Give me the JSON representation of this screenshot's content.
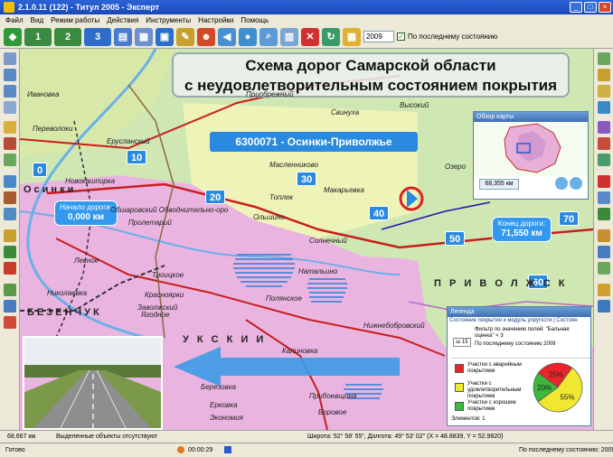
{
  "window": {
    "title": "2.1.0.11 (122) - Титул 2005 - Эксперт"
  },
  "menu": [
    "Файл",
    "Вид",
    "Режим работы",
    "Действия",
    "Инструменты",
    "Настройки",
    "Помощь"
  ],
  "toolbar": {
    "year": "2009",
    "last_state_label": "По последнему состоянию",
    "last_state_checked": "✓"
  },
  "map": {
    "title_line1": "Схема дорог Самарской области",
    "title_line2": "с неудовлетворительным состоянием покрытия",
    "route_label": "6300071 - Осинки-Приволжье",
    "km_markers": [
      "0",
      "10",
      "20",
      "30",
      "40",
      "50",
      "60",
      "70"
    ],
    "start": {
      "label": "Начало дороги:",
      "value": "0,000 км"
    },
    "end": {
      "label": "Конец дороги:",
      "value": "71,550 км"
    },
    "places": [
      "Ивановка",
      "Переволоки",
      "Ерусланский",
      "Приобрежный",
      "Свинуха",
      "Высокий",
      "Масленниково",
      "Осинки",
      "Новокашпирка",
      "Топлек",
      "Макарьевка",
      "Озеро",
      "Обшаровский Обводнительно-оро",
      "Ольшино",
      "Пролетарий",
      "Лесное",
      "Троицкое",
      "Полянское",
      "Солнечный",
      "Николаевка",
      "Ягодное",
      "Красноярки",
      "Заволжский",
      "Натальино",
      "Калиновка",
      "Нижнебобровский",
      "Прибоевщина",
      "Боровое",
      "Березовка",
      "Экономия",
      "Ерковка"
    ],
    "regions": {
      "west": "ОСИНКИ",
      "south": "БЕЗЕНЧУК",
      "south_east": "У К С К И И",
      "east": "П Р И В О Л Ж С К"
    }
  },
  "overview": {
    "title": "Обзор карты",
    "scale": "68,355 км"
  },
  "legend": {
    "title": "Легенда",
    "subtitle": "Состояние покрытия и модуль упругости | Состоян",
    "filter": "Фильтр по значению полей: \"Бальная оценка\" < 3",
    "ident": "ш 15",
    "last_state": "По последнему состоянию 2009",
    "items": [
      {
        "label": "Участки с аварийным покрытием",
        "color": "#e8262a"
      },
      {
        "label": "Участки с удовлетворительным покрытием",
        "color": "#f0e830"
      },
      {
        "label": "Участки с хорошим покрытием",
        "color": "#3cb83c"
      }
    ],
    "elements": "Элементов: 1"
  },
  "chart_data": {
    "type": "pie",
    "categories": [
      "аварийным",
      "удовлетворительным",
      "хорошим"
    ],
    "values": [
      25,
      55,
      20
    ],
    "labels": [
      "25%",
      "55%",
      "20%"
    ]
  },
  "status": {
    "distance": "68,667 км",
    "selected": "Выделенные объекты отсутствуют",
    "coords": "Широта: 52° 58' 55\", Долгота: 49° 53' 02\" (X = 48.8839, Y = 52.9820)",
    "ready": "Готово",
    "timer": "00:00:29",
    "last_state": "По последнему состоянию: 2009"
  },
  "colors": {
    "urgent": "#e8262a",
    "satisfactory": "#f0e830",
    "good": "#3cb83c",
    "route": "#2a8ae0"
  }
}
